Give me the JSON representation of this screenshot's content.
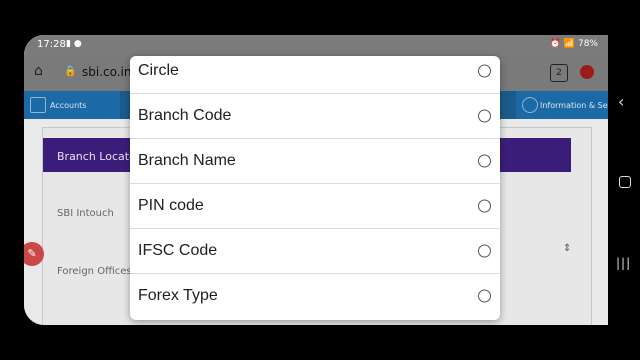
{
  "status": {
    "time": "17:28",
    "battery": "78%"
  },
  "browser": {
    "url": "sbi.co.in/",
    "tab_count": "2"
  },
  "nav": {
    "left": "Accounts",
    "right": "Information & Servi"
  },
  "page": {
    "locator": "Branch Locator",
    "item1": "SBI Intouch",
    "item2": "Foreign Offices"
  },
  "dialog": {
    "options": [
      "Circle",
      "Branch Code",
      "Branch Name",
      "PIN code",
      "IFSC Code",
      "Forex Type"
    ]
  }
}
